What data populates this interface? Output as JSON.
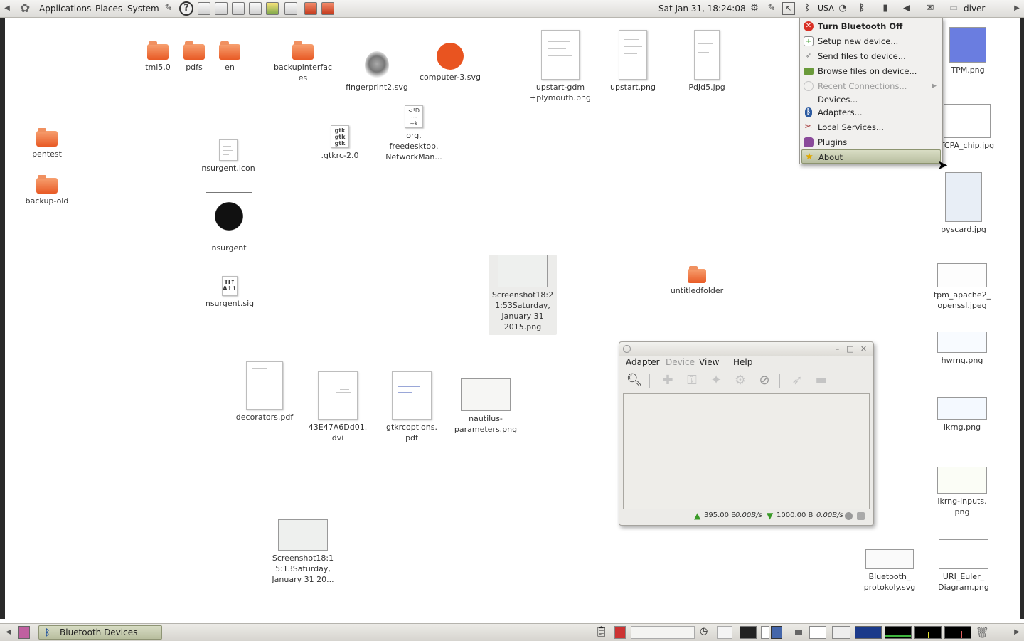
{
  "top_panel": {
    "menus": [
      "Applications",
      "Places",
      "System"
    ],
    "clock": "Sat Jan 31, 18:24:08",
    "keyboard_layout": "USA",
    "user": "diver"
  },
  "desktop_icons": {
    "tml50": "tml5.0",
    "pdfs": "pdfs",
    "en": "en",
    "backupinterfaces": "backupinterfac\nes",
    "fingerprint": "fingerprint2.svg",
    "computer3": "computer-3.svg",
    "upstart_gdm": "upstart-gdm\n+plymouth.png",
    "upstart": "upstart.png",
    "pdjd5": "PdJd5.jpg",
    "tpm": "TPM.png",
    "pentest": "pentest",
    "backup_old": "backup-old",
    "nsurgent_icon": "nsurgent.icon",
    "gtkrc": ".gtkrc-2.0",
    "nm_dbus": "org.\nfreedesktop.\nNetworkMan...",
    "tcpa_chip": "TCPA_chip.jpg",
    "pyscard": "pyscard.jpg",
    "nsurgent": "nsurgent",
    "nsurgent_sig": "nsurgent.sig",
    "screenshot_1": "Screenshot18:2\n1:53Saturday,\nJanuary 31\n2015.png",
    "untitled_folder": "untitledfolder",
    "tpm_apache": "tpm_apache2_\nopenssl.jpeg",
    "hwrng": "hwrng.png",
    "decorators": "decorators.pdf",
    "dvi": "43E47A6Dd01.\ndvi",
    "gtkrcoptions": "gtkrcoptions.\npdf",
    "nautilus_params": "nautilus-\nparameters.png",
    "ikrng": "ikrng.png",
    "ikrng_inputs": "ikrng-inputs.\npng",
    "screenshot_2": "Screenshot18:1\n5:13Saturday,\nJanuary 31 20...",
    "bluetooth_protokoly": "Bluetooth_\nprotokoly.svg",
    "uri_euler": "URI_Euler_\nDiagram.png"
  },
  "bluetooth_menu": {
    "items": [
      {
        "label": "Turn Bluetooth Off",
        "icon": "stop-icon",
        "bold": true
      },
      {
        "label": "Setup new device...",
        "icon": "setup-icon"
      },
      {
        "label": "Send files to device...",
        "icon": "send-icon"
      },
      {
        "label": "Browse files on device...",
        "icon": "folder-icon"
      },
      {
        "label": "Recent Connections...",
        "icon": "recent-icon",
        "disabled": true
      },
      {
        "label": "Devices...",
        "icon": ""
      },
      {
        "label": "Adapters...",
        "icon": "bluetooth-icon"
      },
      {
        "label": "Local Services...",
        "icon": "tools-icon"
      },
      {
        "label": "Plugins",
        "icon": "puzzle-icon"
      },
      {
        "label": "About",
        "icon": "star-icon",
        "selected": true
      }
    ]
  },
  "bt_window": {
    "menus": [
      "Adapter",
      "Device",
      "View",
      "Help"
    ],
    "upload_bytes": "395.00 B",
    "upload_rate": "0.00B/s",
    "download_bytes": "1000.00 B",
    "download_rate": "0.00B/s"
  },
  "bottom_panel": {
    "task": "Bluetooth Devices"
  },
  "colors": {
    "folder": "#e85a25",
    "selection": "#b8bea0",
    "stop_red": "#d93025",
    "arrow_green": "#3a9a28"
  }
}
